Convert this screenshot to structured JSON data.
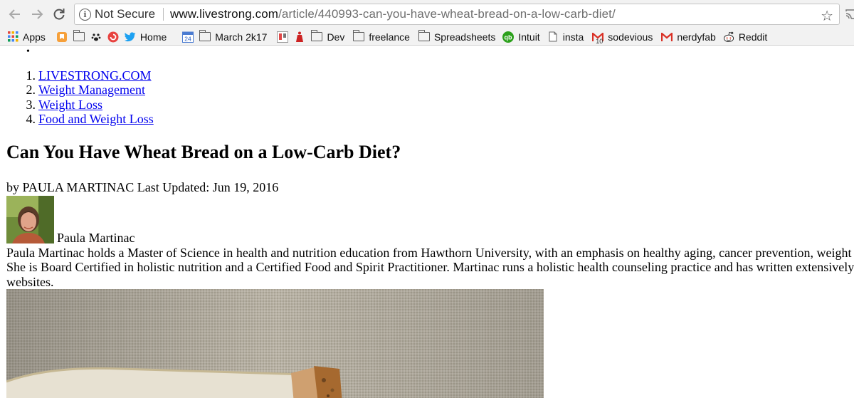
{
  "browser": {
    "security_label": "Not Secure",
    "url_host": "www.livestrong.com",
    "url_path": "/article/440993-can-you-have-wheat-bread-on-a-low-carb-diet/",
    "bookmarks": [
      {
        "label": "Apps",
        "icon": "apps-grid-icon"
      },
      {
        "label": "",
        "icon": "orange-bookmark-icon"
      },
      {
        "label": "",
        "icon": "folder-icon"
      },
      {
        "label": "",
        "icon": "paw-icon"
      },
      {
        "label": "",
        "icon": "pocket-icon"
      },
      {
        "label": "Home",
        "icon": "twitter-icon"
      },
      {
        "label": "",
        "icon": "calendar-icon"
      },
      {
        "label": "March 2k17",
        "icon": "folder-icon"
      },
      {
        "label": "",
        "icon": "trello-icon"
      },
      {
        "label": "",
        "icon": "figure-icon"
      },
      {
        "label": "Dev",
        "icon": "folder-icon"
      },
      {
        "label": "freelance",
        "icon": "folder-icon"
      },
      {
        "label": "Spreadsheets",
        "icon": "folder-icon"
      },
      {
        "label": "Intuit",
        "icon": "quickbooks-icon"
      },
      {
        "label": "insta",
        "icon": "page-icon"
      },
      {
        "label": "sodevious",
        "icon": "gmail-icon"
      },
      {
        "label": "nerdyfab",
        "icon": "gmail-icon"
      },
      {
        "label": "Reddit",
        "icon": "reddit-icon"
      }
    ],
    "calendar_day": "24",
    "gmail_badge": "10",
    "colors": {
      "toolbar_bg": "#f2f2f2",
      "link": "#0000ee"
    }
  },
  "page": {
    "bullet": "•",
    "breadcrumbs": [
      {
        "num": "1.",
        "label": "LIVESTRONG.COM"
      },
      {
        "num": "2.",
        "label": "Weight Management"
      },
      {
        "num": "3.",
        "label": "Weight Loss"
      },
      {
        "num": "4.",
        "label": "Food and Weight Loss"
      }
    ],
    "title": "Can You Have Wheat Bread on a Low-Carb Diet?",
    "byline": "by PAULA MARTINAC Last Updated: Jun 19, 2016",
    "author_name": "Paula Martinac",
    "bio": "Paula Martinac holds a Master of Science in health and nutrition education from Hawthorn University, with an emphasis on healthy aging, cancer prevention, weight c She is Board Certified in holistic nutrition and a Certified Food and Spirit Practitioner. Martinac runs a holistic health counseling practice and has written extensively websites."
  }
}
